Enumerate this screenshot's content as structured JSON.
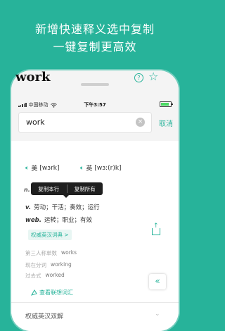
{
  "banner": {
    "line1": "新增快速释义选中复制",
    "line2": "一键复制更高效"
  },
  "status": {
    "carrier": "中国移动",
    "time": "下午3:57"
  },
  "search": {
    "value": "work",
    "cancel_label": "取消"
  },
  "entry": {
    "word": "work",
    "us_label": "美",
    "us_ipa": "[wɜrk]",
    "uk_label": "英",
    "uk_ipa": "[wɜː(r)k]",
    "pos_n": "n.",
    "pos_v": "v.",
    "def_v": "劳动；干活；奏效；运行",
    "pos_web": "web.",
    "def_web": "运转；职业；有效",
    "dict_link": "权威英汉词典 >"
  },
  "tooltip": {
    "copy_line": "复制本行",
    "copy_all": "复制所有"
  },
  "forms": [
    {
      "label": "第三人称单数",
      "value": "works"
    },
    {
      "label": "现在分词",
      "value": "working"
    },
    {
      "label": "过去式",
      "value": "worked"
    }
  ],
  "assoc_label": "查看联想词汇",
  "section_title": "权威英汉双解",
  "colors": {
    "accent": "#27b39a"
  },
  "icons": [
    "wifi-icon",
    "battery-icon",
    "clear-icon",
    "help-icon",
    "star-icon",
    "speaker-icon",
    "share-icon",
    "collapse-icon",
    "assoc-icon"
  ]
}
